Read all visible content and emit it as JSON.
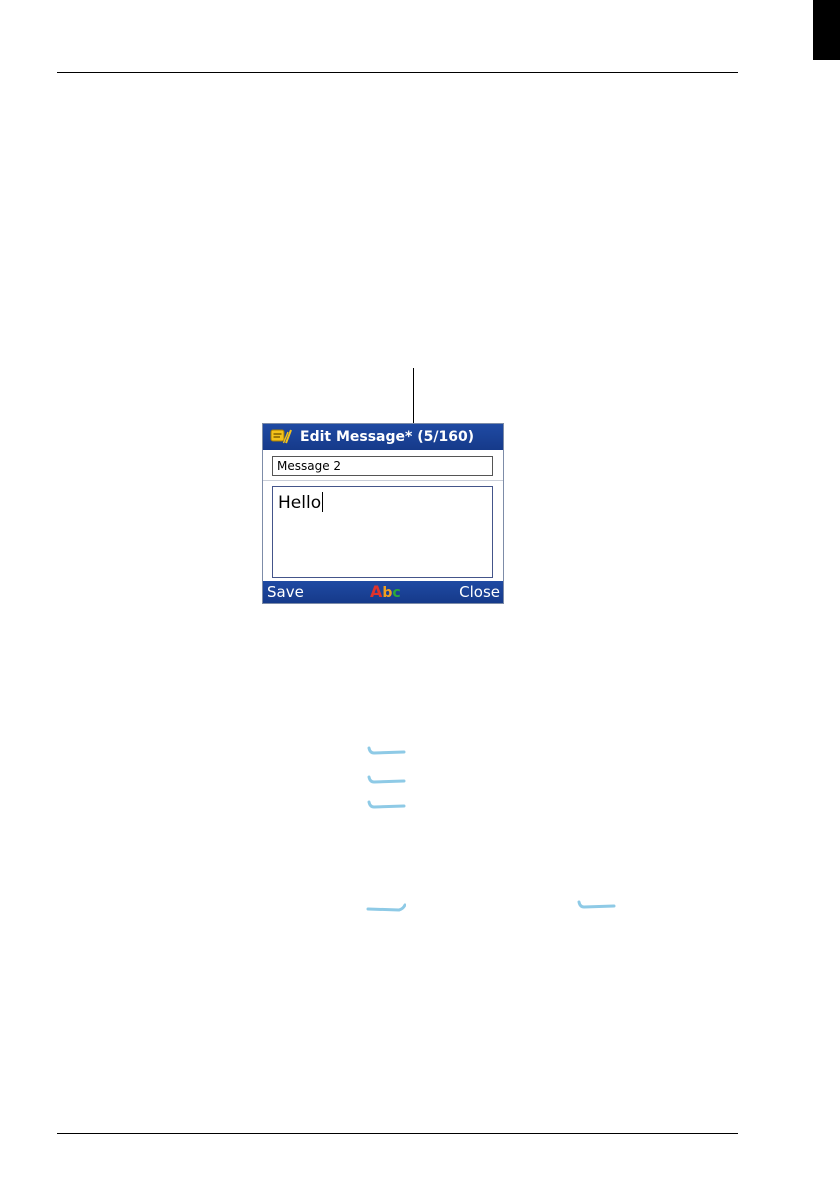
{
  "screen": {
    "title": "Edit Message* (5/160)",
    "name_value": "Message 2",
    "body_text": "Hello",
    "softkeys": {
      "left": "Save",
      "right": "Close"
    },
    "input_mode": [
      "A",
      "b",
      "c"
    ]
  },
  "icons": {
    "title": "message-edit-icon",
    "keys": [
      "key-mark-icon",
      "key-mark-icon",
      "key-mark-icon",
      "key-mark-icon",
      "key-mark-icon"
    ]
  },
  "colors": {
    "titlebar": "#1f4aa3",
    "key_mark": "#8ecae6",
    "input_mode": [
      "#e0332b",
      "#f0a020",
      "#2aa83a"
    ]
  }
}
